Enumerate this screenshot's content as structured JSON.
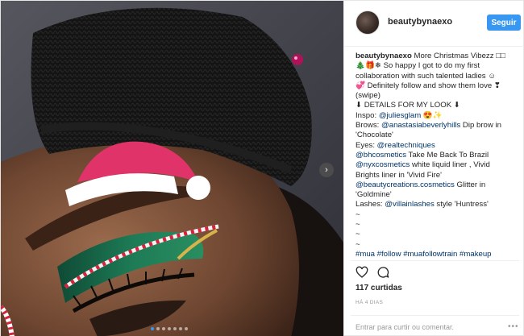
{
  "post": {
    "username": "beautybynaexo",
    "follow_label": "Seguir",
    "caption_lines": [
      {
        "parts": [
          {
            "t": "beautybynaexo",
            "k": "u"
          },
          {
            "t": " More Christmas Vibezz □□"
          }
        ]
      },
      {
        "parts": [
          {
            "t": "🎄🎁❄ So happy I got to do my first"
          }
        ]
      },
      {
        "parts": [
          {
            "t": "collaboration with such talented ladies ☺"
          }
        ]
      },
      {
        "parts": [
          {
            "t": "💞 Definitely follow and show them love ❣"
          }
        ]
      },
      {
        "parts": [
          {
            "t": "(swipe)"
          }
        ]
      },
      {
        "parts": [
          {
            "t": "⬇ DETAILS FOR MY LOOK ⬇"
          }
        ]
      },
      {
        "parts": [
          {
            "t": "Inspo: "
          },
          {
            "t": "@juliesglam",
            "k": "link"
          },
          {
            "t": " 😍✨"
          }
        ]
      },
      {
        "parts": [
          {
            "t": "Brows: "
          },
          {
            "t": "@anastasiabeverlyhills",
            "k": "link"
          },
          {
            "t": " Dip brow in"
          }
        ]
      },
      {
        "parts": [
          {
            "t": "'Chocolate'"
          }
        ]
      },
      {
        "parts": [
          {
            "t": "Eyes: "
          },
          {
            "t": "@realtechniques",
            "k": "link"
          }
        ]
      },
      {
        "parts": [
          {
            "t": "@bhcosmetics",
            "k": "link"
          },
          {
            "t": " Take Me Back To Brazil"
          }
        ]
      },
      {
        "parts": [
          {
            "t": "@nyxcosmetics",
            "k": "link"
          },
          {
            "t": " white liquid liner , Vivid"
          }
        ]
      },
      {
        "parts": [
          {
            "t": "Brights liner in 'Vivid Fire'"
          }
        ]
      },
      {
        "parts": [
          {
            "t": "@beautycreations.cosmetics",
            "k": "link"
          },
          {
            "t": " Glitter in"
          }
        ]
      },
      {
        "parts": [
          {
            "t": "'Goldmine'"
          }
        ]
      },
      {
        "parts": [
          {
            "t": "Lashes: "
          },
          {
            "t": "@villainlashes",
            "k": "link"
          },
          {
            "t": " style 'Huntress'"
          }
        ]
      },
      {
        "parts": [
          {
            "t": "~"
          }
        ]
      },
      {
        "parts": [
          {
            "t": "~"
          }
        ]
      },
      {
        "parts": [
          {
            "t": "~"
          }
        ]
      },
      {
        "parts": [
          {
            "t": "~"
          }
        ]
      },
      {
        "parts": [
          {
            "t": "#mua #follow #muafollowtrain #makeup",
            "k": "link"
          }
        ]
      }
    ],
    "likes_label": "117 curtidas",
    "time_label": "HÁ 4 DIAS",
    "comment_placeholder": "Entrar para curtir ou comentar.",
    "more_label": "•••",
    "carousel_next_label": "›",
    "carousel_dots": 7,
    "carousel_active_index": 0
  },
  "icons": {
    "like": "heart-outline-icon",
    "comment": "speech-bubble-icon",
    "next": "chevron-right-icon",
    "more": "ellipsis-icon"
  },
  "colors": {
    "follow_button": "#3897f0",
    "link": "#003569",
    "secondary_text": "#999999"
  }
}
